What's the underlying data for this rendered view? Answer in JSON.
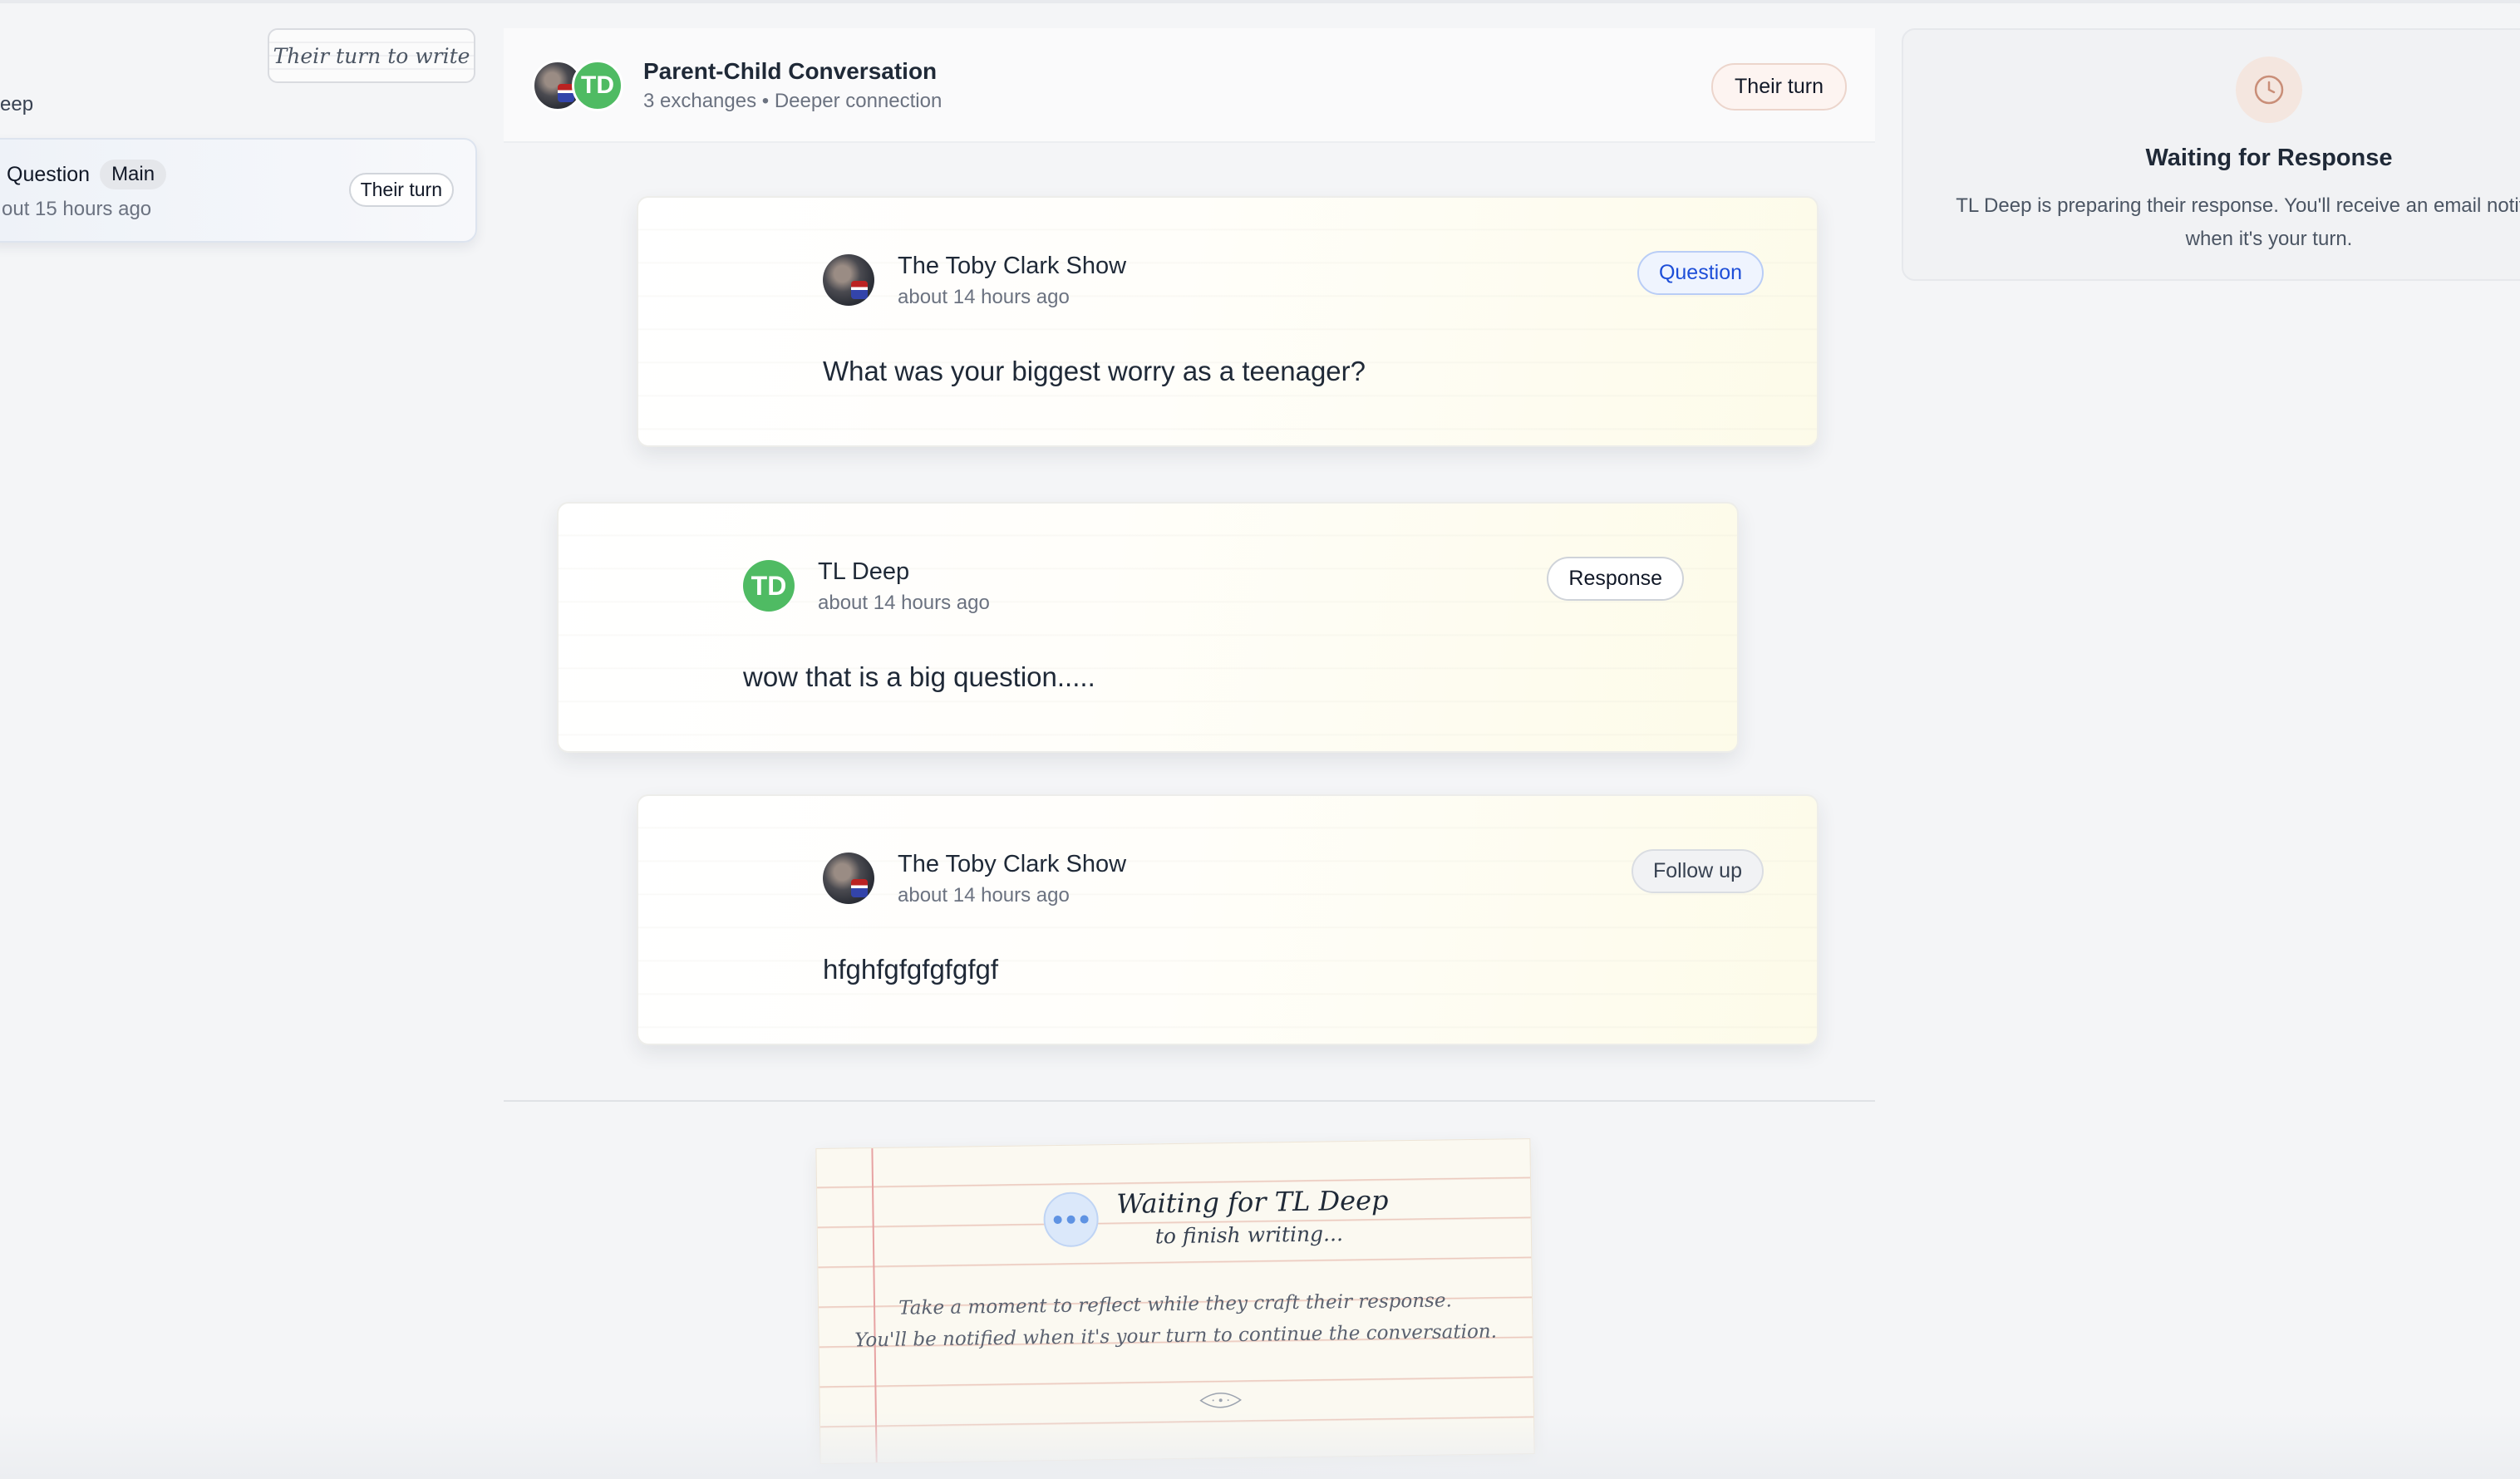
{
  "sidebar": {
    "turn_tag": "Their turn to write",
    "partial_name": "eep",
    "conversation": {
      "title": "Question",
      "badge": "Main",
      "time": "out 15 hours ago",
      "status": "Their turn"
    }
  },
  "header": {
    "title": "Parent-Child Conversation",
    "subtitle": "3 exchanges • Deeper connection",
    "status": "Their turn",
    "avatar_initials": "TD"
  },
  "messages": [
    {
      "author": "The Toby Clark Show",
      "time": "about 14 hours ago",
      "type": "Question",
      "text": "What was your biggest worry as a teenager?"
    },
    {
      "author": "TL Deep",
      "initials": "TD",
      "time": "about 14 hours ago",
      "type": "Response",
      "text": "wow that is a big question....."
    },
    {
      "author": "The Toby Clark Show",
      "time": "about 14 hours ago",
      "type": "Follow up",
      "text": "hfghfgfgfgfgfgf"
    }
  ],
  "waiting_note": {
    "title": "Waiting for TL Deep",
    "subtitle": "to finish writing...",
    "line1": "Take a moment to reflect while they craft their response.",
    "line2": "You'll be notified when it's your turn to continue the conversation."
  },
  "right_panel": {
    "title": "Waiting for Response",
    "text": "TL Deep is preparing their response. You'll receive an email notification when it's your turn."
  },
  "colors": {
    "accent_green": "#4fbb63",
    "question_blue": "#1d4ed8",
    "note_line": "#e9c2b6",
    "clock_accent": "#c98e78"
  }
}
